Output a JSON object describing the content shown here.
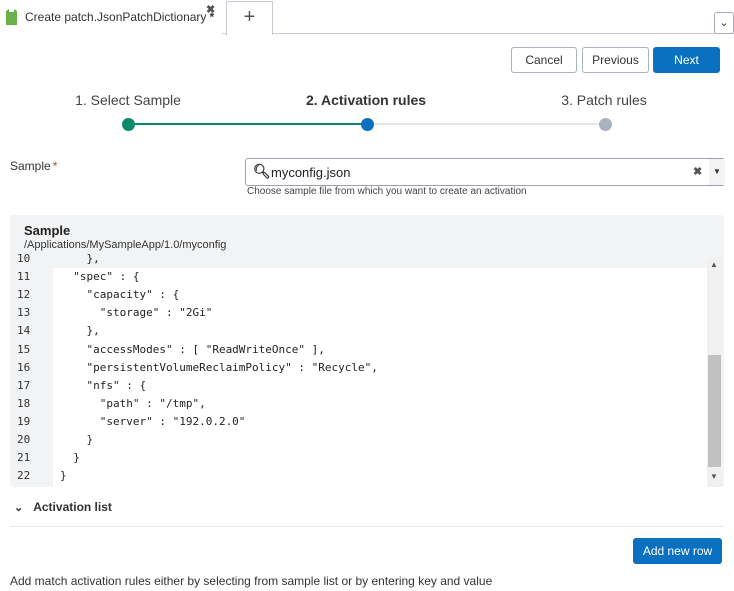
{
  "tabs": {
    "active_label": "Create patch.JsonPatchDictionary",
    "modified_marker": "*",
    "close_icon": "close-icon",
    "new_tab_label": "+",
    "menu_icon": "chevron-down-icon"
  },
  "toolbar": {
    "cancel": "Cancel",
    "previous": "Previous",
    "next": "Next"
  },
  "steps": [
    {
      "label": "1. Select Sample",
      "state": "done"
    },
    {
      "label": "2. Activation rules",
      "state": "active"
    },
    {
      "label": "3. Patch rules",
      "state": "pending"
    }
  ],
  "colors": {
    "done": "#0a8a6a",
    "active": "#0a70c0",
    "pending": "#aab2bd",
    "primary": "#0a70c0"
  },
  "sample_field": {
    "label": "Sample",
    "required": "*",
    "value": "myconfig.json",
    "help": "Choose sample file from which you want to create an activation"
  },
  "sample_panel": {
    "title": "Sample",
    "path": "/Applications/MySampleApp/1.0/myconfig",
    "lines": [
      {
        "n": "10",
        "text": "    },"
      },
      {
        "n": "11",
        "text": "  \"spec\" : {"
      },
      {
        "n": "12",
        "text": "    \"capacity\" : {"
      },
      {
        "n": "13",
        "text": "      \"storage\" : \"2Gi\""
      },
      {
        "n": "14",
        "text": "    },"
      },
      {
        "n": "15",
        "text": "    \"accessModes\" : [ \"ReadWriteOnce\" ],"
      },
      {
        "n": "16",
        "text": "    \"persistentVolumeReclaimPolicy\" : \"Recycle\","
      },
      {
        "n": "17",
        "text": "    \"nfs\" : {"
      },
      {
        "n": "18",
        "text": "      \"path\" : \"/tmp\","
      },
      {
        "n": "19",
        "text": "      \"server\" : \"192.0.2.0\""
      },
      {
        "n": "20",
        "text": "    }"
      },
      {
        "n": "21",
        "text": "  }"
      },
      {
        "n": "22",
        "text": "}"
      }
    ]
  },
  "activation": {
    "section_label": "Activation list",
    "add_row": "Add new row",
    "hint": "Add match activation rules either by selecting from sample list or by entering key and value"
  }
}
